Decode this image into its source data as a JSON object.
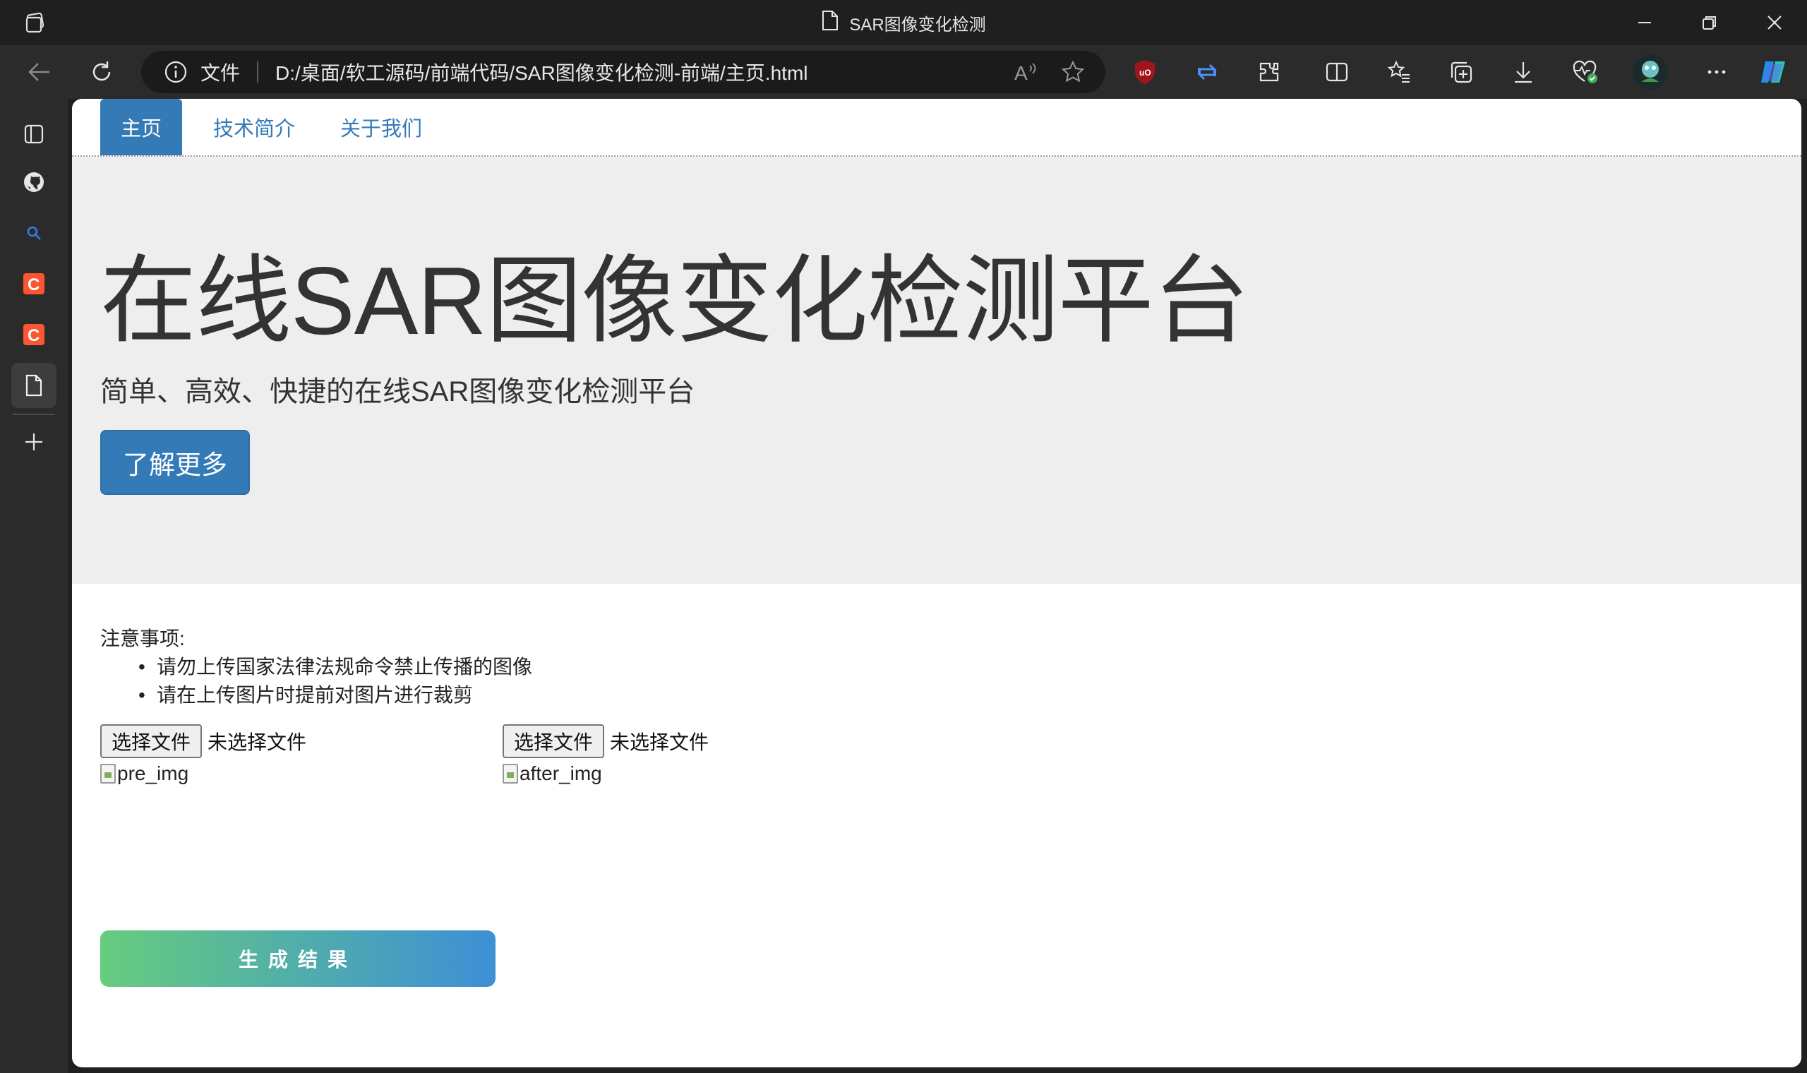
{
  "window": {
    "title": "SAR图像变化检测"
  },
  "toolbar": {
    "address_scheme_label": "文件",
    "url": "D:/桌面/软工源码/前端代码/SAR图像变化检测-前端/主页.html"
  },
  "nav": {
    "tabs": [
      {
        "label": "主页",
        "active": true
      },
      {
        "label": "技术简介",
        "active": false
      },
      {
        "label": "关于我们",
        "active": false
      }
    ]
  },
  "hero": {
    "title": "在线SAR图像变化检测平台",
    "subtitle": "简单、高效、快捷的在线SAR图像变化检测平台",
    "button_label": "了解更多"
  },
  "notes": {
    "heading": "注意事项:",
    "items": [
      "请勿上传国家法律法规命令禁止传播的图像",
      "请在上传图片时提前对图片进行裁剪"
    ]
  },
  "upload": {
    "pre": {
      "button_label": "选择文件",
      "status": "未选择文件",
      "img_alt": "pre_img"
    },
    "after": {
      "button_label": "选择文件",
      "status": "未选择文件",
      "img_alt": "after_img"
    }
  },
  "generate": {
    "label": "生成结果"
  },
  "colors": {
    "accent": "#337ab7",
    "jumbotron_bg": "#eeeeee",
    "gradient_start": "#66cc7e",
    "gradient_end": "#3d8fd6"
  },
  "icons": {
    "sidebar": [
      "tabs-icon",
      "github-icon",
      "search-icon",
      "csdn-icon",
      "csdn-icon",
      "file-icon",
      "add-icon"
    ],
    "toolbar": [
      "back-icon",
      "refresh-icon",
      "info-icon",
      "read-aloud-icon",
      "favorite-star-icon",
      "ublock-icon",
      "sync-icon",
      "extensions-icon",
      "split-screen-icon",
      "favorites-icon",
      "collections-icon",
      "download-icon",
      "health-icon",
      "avatar",
      "more-icon",
      "copilot-icon"
    ]
  }
}
